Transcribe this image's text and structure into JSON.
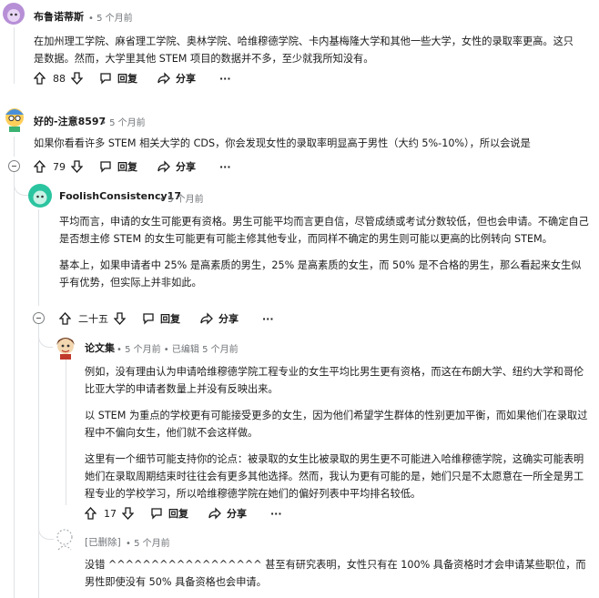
{
  "comments": [
    {
      "username": "布鲁诺蒂斯",
      "time": "5 个月前",
      "paragraphs": [
        "在加州理工学院、麻省理工学院、奥林学院、哈维穆德学院、卡内基梅隆大学和其他一些大学，女性的录取率更高。这只是数据。然而，大学里其他 STEM 项目的数据并不多，至少就我所知没有。"
      ],
      "votes": "88",
      "reply_label": "回复",
      "share_label": "分享",
      "more_label": "···",
      "avatar_color": "#b78fd6"
    },
    {
      "username": "好的-注意8597",
      "time": "5 个月前",
      "paragraphs": [
        "如果你看看许多 STEM 相关大学的 CDS，你会发现女性的录取率明显高于男性（大约 5%-10%），所以会说是"
      ],
      "votes": "79",
      "reply_label": "回复",
      "share_label": "分享",
      "more_label": "···",
      "avatar_color": "#4a8fd9"
    },
    {
      "username": "FoolishConsistency17",
      "time": "5 个月前",
      "paragraphs": [
        "平均而言，申请的女生可能更有资格。男生可能平均而言更自信，尽管成绩或考试分数较低，但也会申请。不确定自己是否想主修 STEM 的女生可能更有可能主修其他专业，而同样不确定的男生则可能以更高的比例转向 STEM。",
        "基本上，如果申请者中 25% 是高素质的男生，25% 是高素质的女生，而 50% 是不合格的男生，那么看起来女生似乎有优势，但实际上并非如此。"
      ],
      "votes": "二十五",
      "reply_label": "回复",
      "share_label": "分享",
      "more_label": "···",
      "avatar_color": "#2bc4a0"
    },
    {
      "username": "论文集",
      "time": "5 个月前",
      "edited": "已编辑 5 个月前",
      "paragraphs": [
        "例如，没有理由认为申请哈维穆德学院工程专业的女生平均比男生更有资格，而这在布朗大学、纽约大学和哥伦比亚大学的申请者数量上并没有反映出来。",
        "以 STEM 为重点的学校更有可能接受更多的女生，因为他们希望学生群体的性别更加平衡，而如果他们在录取过程中不偏向女生，他们就不会这样做。",
        "这里有一个细节可能支持你的论点：被录取的女生比被录取的男生更不可能进入哈维穆德学院，这确实可能表明她们在录取周期结束时往往会有更多其他选择。然而，我认为更有可能的是，她们只是不太愿意在一所全是男工程专业的学校学习，所以哈维穆德学院在她们的偏好列表中平均排名较低。"
      ],
      "votes": "17",
      "reply_label": "回复",
      "share_label": "分享",
      "more_label": "···",
      "avatar_color": "#d9a441"
    },
    {
      "username": "[已删除]",
      "time": "5 个月前",
      "paragraphs": [
        "没错 ^^^^^^^^^^^^^^^^^^ 甚至有研究表明，女性只有在 100% 具备资格时才会申请某些职位，而男性即使没有 50% 具备资格也会申请。"
      ]
    }
  ]
}
